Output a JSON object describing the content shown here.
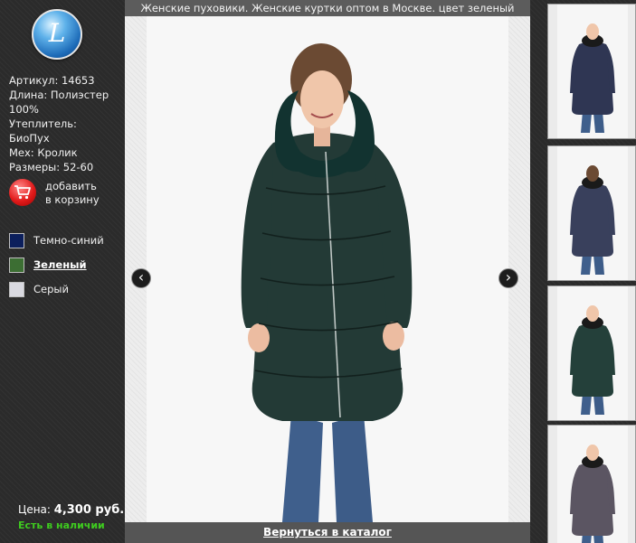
{
  "logo": {
    "letter": "L"
  },
  "product": {
    "specs": [
      "Артикул: 14653",
      "Длина: Полиэстер",
      "100%",
      "Утеплитель:",
      "БиоПух",
      "Мех: Кролик",
      "Размеры: 52-60"
    ],
    "cart": {
      "line1": "добавить",
      "line2": "в корзину",
      "icon": "shopping-cart-icon"
    },
    "colors": [
      {
        "name": "Темно-синий",
        "hex": "#0c1f5c",
        "active": false
      },
      {
        "name": "Зеленый",
        "hex": "#3c6e33",
        "active": true
      },
      {
        "name": "Серый",
        "hex": "#d9d9e0",
        "active": false
      }
    ],
    "price": {
      "label": "Цена:",
      "value": "4,300 руб."
    },
    "stock": "Есть в наличии",
    "jacket_color": "#233a36"
  },
  "viewer": {
    "caption": "Женские пуховики. Женские куртки оптом в Москве. цвет зеленый",
    "back_link": "Вернуться в каталог",
    "prev_icon": "‹",
    "next_icon": "›"
  },
  "thumbnails": [
    {
      "jacket": "#2f3653",
      "view": "front"
    },
    {
      "jacket": "#39405c",
      "view": "back"
    },
    {
      "jacket": "#24403a",
      "view": "front"
    },
    {
      "jacket": "#5b5562",
      "view": "front"
    }
  ]
}
